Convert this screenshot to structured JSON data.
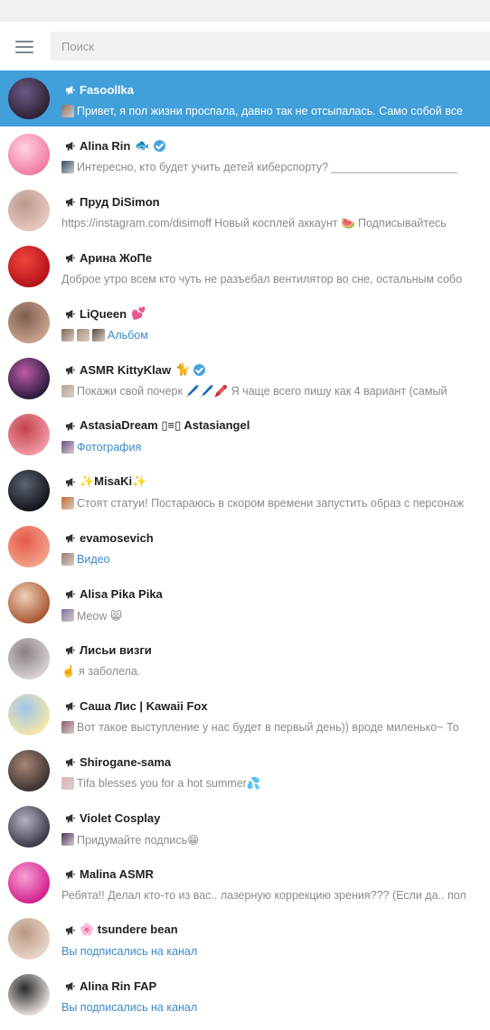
{
  "search": {
    "placeholder": "Поиск"
  },
  "chats": [
    {
      "name": "Fasoollka",
      "message": "Привет, я пол жизни проспала, давно так не отсыпалась. Само собой все",
      "thumbs": [
        "#8c6d6a"
      ],
      "media": false,
      "verified": false,
      "badge": "",
      "active": true,
      "avatar": [
        "#2b2033",
        "#6d5a85"
      ]
    },
    {
      "name": "Alina Rin",
      "badge": "🐟",
      "verified": true,
      "message": "Интересно, кто будет учить детей киберспорту? ____________________",
      "thumbs": [
        "#2c4c6a"
      ],
      "media": false,
      "avatar": [
        "#f07aa0",
        "#ffd3e0"
      ]
    },
    {
      "name": "Пруд DiSimon",
      "message": "https://instagram.com/disimoff Новый косплей аккаунт 🍉 Подписывайтесь",
      "thumbs": [],
      "media": false,
      "verified": false,
      "badge": "",
      "avatar": [
        "#e8c9c0",
        "#b99a8c"
      ]
    },
    {
      "name": "Арина ЖоПе",
      "message": "Доброе утро всем кто чуть не разъебал вентилятор во сне, остальным собо",
      "thumbs": [],
      "media": false,
      "verified": false,
      "badge": "",
      "avatar": [
        "#b3121b",
        "#f0453c"
      ]
    },
    {
      "name": "LiQueen",
      "badge": "💕",
      "message": "Альбом",
      "thumbs": [
        "#7a6556",
        "#a88c74",
        "#5d4a3d"
      ],
      "media": true,
      "verified": false,
      "avatar": [
        "#c9a48e",
        "#7d5e4f"
      ]
    },
    {
      "name": "ASMR KittyKlaw",
      "badge": "🐈",
      "verified": true,
      "message": "Покажи свой почерк 🖊️🖊️🖍️ Я чаще всего пишу как 4 вариант (самый",
      "thumbs": [
        "#b9a595"
      ],
      "media": false,
      "avatar": [
        "#251a3a",
        "#c05aa8"
      ]
    },
    {
      "name": "AstasiaDream ▯≡▯ Astasiangel",
      "message": "Фотография",
      "thumbs": [
        "#6b4b8a"
      ],
      "media": true,
      "verified": false,
      "badge": "",
      "avatar": [
        "#f29aa4",
        "#c2424e"
      ]
    },
    {
      "name": "✨MisaKi✨",
      "message": "Стоят статуи! Постараюсь в скором времени запустить образ с персонаж",
      "thumbs": [
        "#c26a2e"
      ],
      "media": false,
      "verified": false,
      "badge": "",
      "avatar": [
        "#101218",
        "#5b6472"
      ]
    },
    {
      "name": "evamosevich",
      "message": "Видео",
      "thumbs": [
        "#9c7a72"
      ],
      "media": true,
      "verified": false,
      "badge": "",
      "avatar": [
        "#f2a38a",
        "#e75a4a"
      ]
    },
    {
      "name": "Alisa Pika Pika",
      "message": "Meow 😸",
      "thumbs": [
        "#7c6ea0"
      ],
      "media": false,
      "verified": false,
      "badge": "",
      "avatar": [
        "#a6552f",
        "#f0d0b8"
      ]
    },
    {
      "name": "Лисьи визги",
      "message": "☝️ я заболела.",
      "thumbs": [],
      "media": false,
      "verified": false,
      "badge": "",
      "avatar": [
        "#d8d3d6",
        "#8a8087"
      ]
    },
    {
      "name": "Саша Лис | Kawaii Fox",
      "message": "Вот такое выступление у нас будет в первый день)) вроде миленько~  То",
      "thumbs": [
        "#8c5a6a"
      ],
      "media": false,
      "verified": false,
      "badge": "",
      "avatar": [
        "#f6e6a8",
        "#9ec6ea"
      ]
    },
    {
      "name": "Shirogane-sama",
      "message": "Tifa blesses you for a hot summer💦",
      "thumbs": [
        "#e0b2b8"
      ],
      "media": false,
      "verified": false,
      "badge": "",
      "avatar": [
        "#3b3030",
        "#a68775"
      ]
    },
    {
      "name": "Violet Cosplay",
      "message": "Придумайте подпись😁",
      "thumbs": [
        "#4b3560"
      ],
      "media": false,
      "verified": false,
      "badge": "",
      "avatar": [
        "#3a3644",
        "#b7b0c4"
      ]
    },
    {
      "name": "Malina ASMR",
      "message": "Ребята!! Делал кто-то из вас.. лазерную коррекцию зрения??? (Если да.. пол",
      "thumbs": [],
      "media": false,
      "verified": false,
      "badge": "",
      "avatar": [
        "#d21d8c",
        "#f7a1d4"
      ]
    },
    {
      "name": "🌸 tsundere bean",
      "message": "Вы подписались на канал",
      "thumbs": [],
      "media": true,
      "verified": false,
      "badge": "",
      "avatar": [
        "#ead7c9",
        "#b79884"
      ]
    },
    {
      "name": "Alina Rin FAP",
      "message": "Вы подписались на канал",
      "thumbs": [],
      "media": true,
      "verified": false,
      "badge": "",
      "avatar": [
        "#e9e2dd",
        "#2c2a2a"
      ]
    }
  ]
}
